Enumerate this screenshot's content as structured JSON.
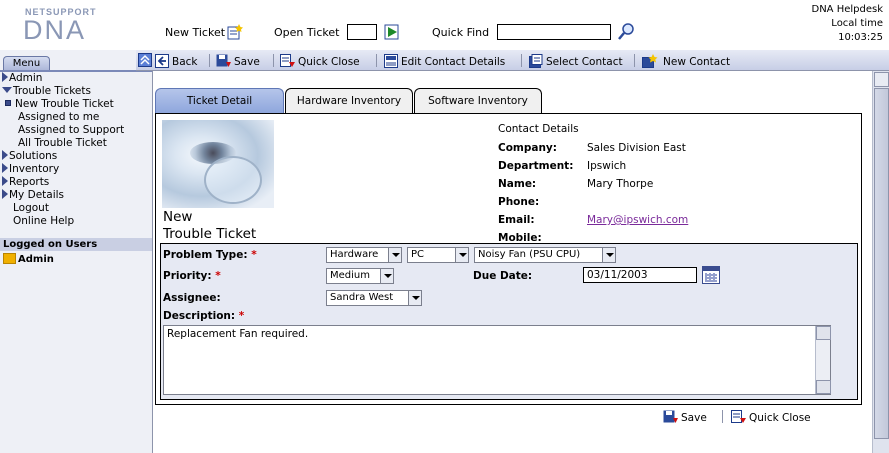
{
  "header": {
    "logo_small": "NETSUPPORT",
    "logo_big": "DNA",
    "new_ticket": "New Ticket",
    "open_ticket": "Open Ticket",
    "open_ticket_value": "",
    "quick_find": "Quick Find",
    "quick_find_value": "",
    "app_name": "DNA Helpdesk",
    "local_time_label": "Local time",
    "local_time": "10:03:25"
  },
  "sidebar": {
    "menu_tab": "Menu",
    "items": [
      {
        "label": "Admin",
        "type": "collapsed"
      },
      {
        "label": "Trouble Tickets",
        "type": "expanded"
      },
      {
        "label": "New Trouble Ticket",
        "type": "selected"
      },
      {
        "label": "Assigned to me",
        "type": "child"
      },
      {
        "label": "Assigned to Support",
        "type": "child"
      },
      {
        "label": "All Trouble Ticket",
        "type": "child"
      },
      {
        "label": "Solutions",
        "type": "collapsed"
      },
      {
        "label": "Inventory",
        "type": "collapsed"
      },
      {
        "label": "Reports",
        "type": "collapsed"
      },
      {
        "label": "My Details",
        "type": "collapsed"
      },
      {
        "label": "Logout",
        "type": "plain"
      },
      {
        "label": "Online Help",
        "type": "plain"
      }
    ],
    "logged_header": "Logged on Users",
    "logged_user": "Admin"
  },
  "toolbar": {
    "back": "Back",
    "save": "Save",
    "quick_close": "Quick Close",
    "edit_contact": "Edit Contact Details",
    "select_contact": "Select Contact",
    "new_contact": "New Contact"
  },
  "tabs": {
    "ticket_detail": "Ticket Detail",
    "hardware_inventory": "Hardware Inventory",
    "software_inventory": "Software Inventory"
  },
  "page": {
    "title_line1": "New",
    "title_line2": "Trouble Ticket"
  },
  "contact": {
    "header": "Contact Details",
    "company_label": "Company:",
    "company": "Sales Division East",
    "department_label": "Department:",
    "department": "Ipswich",
    "name_label": "Name:",
    "name": "Mary Thorpe",
    "phone_label": "Phone:",
    "phone": "",
    "email_label": "Email:",
    "email": "Mary@ipswich.com",
    "mobile_label": "Mobile:",
    "mobile": ""
  },
  "form": {
    "problem_type_label": "Problem Type:",
    "required_mark": "*",
    "problem_type_1": "Hardware",
    "problem_type_2": "PC",
    "problem_type_3": "Noisy Fan (PSU CPU)",
    "priority_label": "Priority:",
    "priority": "Medium",
    "due_date_label": "Due Date:",
    "due_date": "03/11/2003",
    "assignee_label": "Assignee:",
    "assignee": "Sandra West",
    "description_label": "Description:",
    "description": "Replacement Fan required."
  },
  "footer": {
    "save": "Save",
    "quick_close": "Quick Close"
  },
  "colors": {
    "accent": "#8da5dc",
    "sidebar_bg": "#eef0f6",
    "form_bg": "#e6e9f3",
    "required": "#cc0000",
    "link": "#7a2a9a"
  }
}
